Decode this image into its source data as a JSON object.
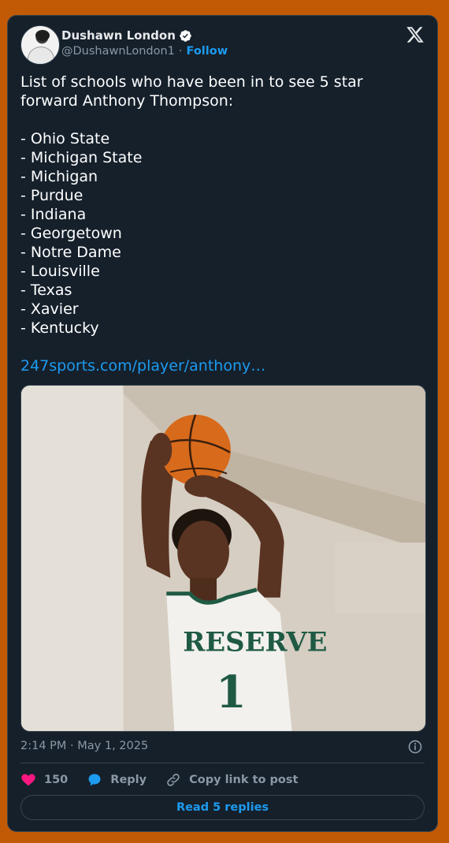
{
  "author": {
    "name": "Dushawn London",
    "handle": "@DushawnLondon1",
    "separator": "·",
    "follow_label": "Follow"
  },
  "tweet": {
    "text": "List of schools who have been in to see 5 star forward Anthony Thompson:\n\n- Ohio State\n- Michigan State\n- Michigan\n- Purdue\n- Indiana\n- Georgetown\n- Notre Dame\n- Louisville\n- Texas\n- Xavier\n- Kentucky",
    "link": "247sports.com/player/anthony…",
    "photo_jersey_text": "RESERVE",
    "photo_jersey_number": "1",
    "timestamp": "2:14 PM · May 1, 2025"
  },
  "actions": {
    "like_count": "150",
    "reply_label": "Reply",
    "copy_label": "Copy link to post",
    "read_replies_label": "Read 5 replies"
  },
  "colors": {
    "background": "#c25a05",
    "card": "#15202b",
    "accent": "#1d9bf0",
    "like": "#f91880"
  },
  "icons": [
    "verified-badge-icon",
    "x-logo-icon",
    "info-icon",
    "heart-icon",
    "reply-bubble-icon",
    "link-icon"
  ]
}
